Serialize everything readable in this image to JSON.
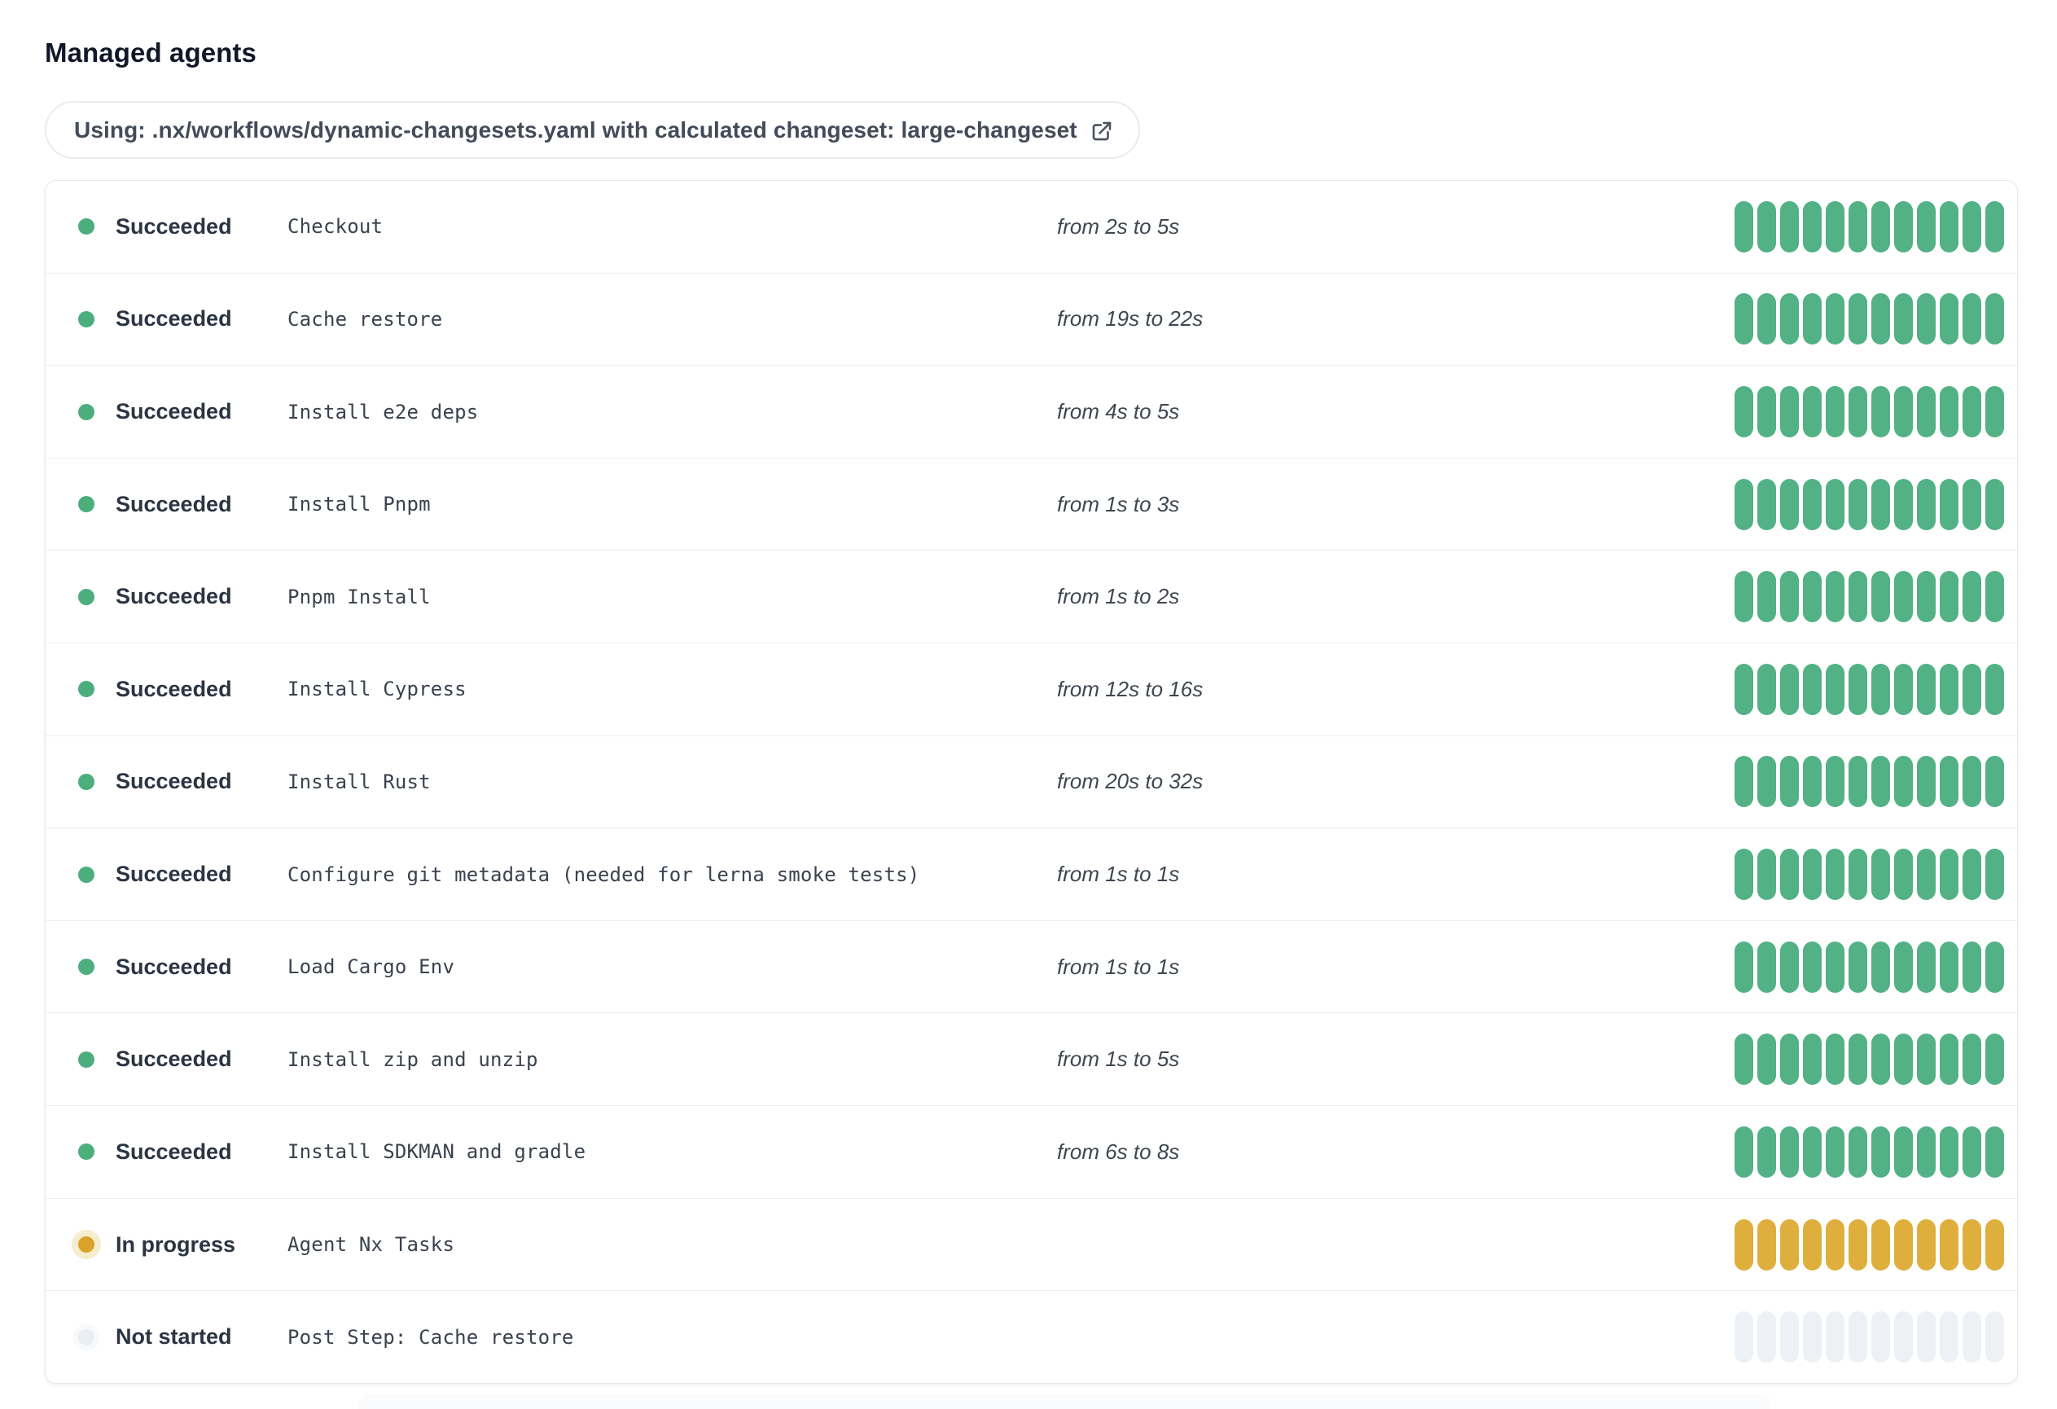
{
  "header": {
    "title": "Managed agents"
  },
  "workflow_banner": {
    "label": "Using: .nx/workflows/dynamic-changesets.yaml with calculated changeset: large-changeset",
    "icon": "external-link-icon"
  },
  "progress": {
    "segments": 12
  },
  "status_colors": {
    "succeeded_dot": "#4cae7d",
    "succeeded_pill": "#52b185",
    "in_progress_dot": "#d9a32a",
    "in_progress_halo": "#f6ecce",
    "in_progress_pill": "#dfaf3e",
    "not_started_dot": "#e9eef4",
    "not_started_pill": "#edf1f6"
  },
  "steps": [
    {
      "status": "Succeeded",
      "state": "succeeded",
      "name": "Checkout",
      "duration": "from 2s to 5s"
    },
    {
      "status": "Succeeded",
      "state": "succeeded",
      "name": "Cache restore",
      "duration": "from 19s to 22s"
    },
    {
      "status": "Succeeded",
      "state": "succeeded",
      "name": "Install e2e deps",
      "duration": "from 4s to 5s"
    },
    {
      "status": "Succeeded",
      "state": "succeeded",
      "name": "Install Pnpm",
      "duration": "from 1s to 3s"
    },
    {
      "status": "Succeeded",
      "state": "succeeded",
      "name": "Pnpm Install",
      "duration": "from 1s to 2s"
    },
    {
      "status": "Succeeded",
      "state": "succeeded",
      "name": "Install Cypress",
      "duration": "from 12s to 16s"
    },
    {
      "status": "Succeeded",
      "state": "succeeded",
      "name": "Install Rust",
      "duration": "from 20s to 32s"
    },
    {
      "status": "Succeeded",
      "state": "succeeded",
      "name": "Configure git metadata (needed for lerna smoke tests)",
      "duration": "from 1s to 1s"
    },
    {
      "status": "Succeeded",
      "state": "succeeded",
      "name": "Load Cargo Env",
      "duration": "from 1s to 1s"
    },
    {
      "status": "Succeeded",
      "state": "succeeded",
      "name": "Install zip and unzip",
      "duration": "from 1s to 5s"
    },
    {
      "status": "Succeeded",
      "state": "succeeded",
      "name": "Install SDKMAN and gradle",
      "duration": "from 6s to 8s"
    },
    {
      "status": "In progress",
      "state": "in_progress",
      "name": "Agent Nx Tasks",
      "duration": ""
    },
    {
      "status": "Not started",
      "state": "not_started",
      "name": "Post Step: Cache restore",
      "duration": ""
    }
  ]
}
